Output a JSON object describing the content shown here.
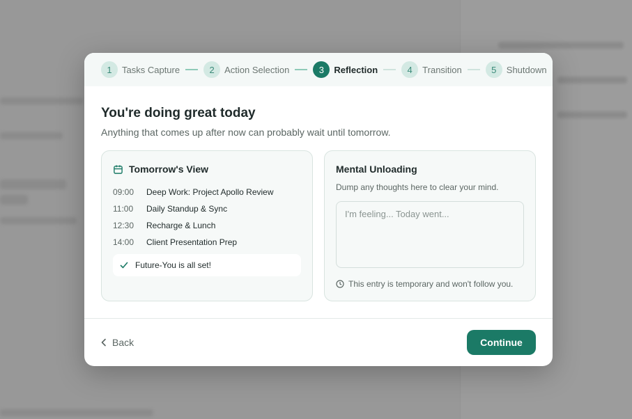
{
  "stepper": {
    "steps": [
      {
        "num": "1",
        "label": "Tasks Capture"
      },
      {
        "num": "2",
        "label": "Action Selection"
      },
      {
        "num": "3",
        "label": "Reflection"
      },
      {
        "num": "4",
        "label": "Transition"
      },
      {
        "num": "5",
        "label": "Shutdown"
      }
    ],
    "active_step": 3
  },
  "header": {
    "title": "You're doing great today",
    "subtitle": "Anything that comes up after now can probably wait until tomorrow."
  },
  "tomorrow": {
    "title": "Tomorrow's View",
    "icon": "calendar-icon",
    "events": [
      {
        "time": "09:00",
        "task": "Deep Work: Project Apollo Review"
      },
      {
        "time": "11:00",
        "task": "Daily Standup & Sync"
      },
      {
        "time": "12:30",
        "task": "Recharge & Lunch"
      },
      {
        "time": "14:00",
        "task": "Client Presentation Prep"
      }
    ],
    "all_set": "Future-You is all set!"
  },
  "mental": {
    "title": "Mental Unloading",
    "description": "Dump any thoughts here to clear your mind.",
    "placeholder": "I'm feeling... Today went...",
    "value": "",
    "note": "This entry is temporary and won't follow you."
  },
  "footer": {
    "back_label": "Back",
    "continue_label": "Continue"
  },
  "colors": {
    "accent": "#1b7a66",
    "step_inactive": "#d3e9e3"
  }
}
